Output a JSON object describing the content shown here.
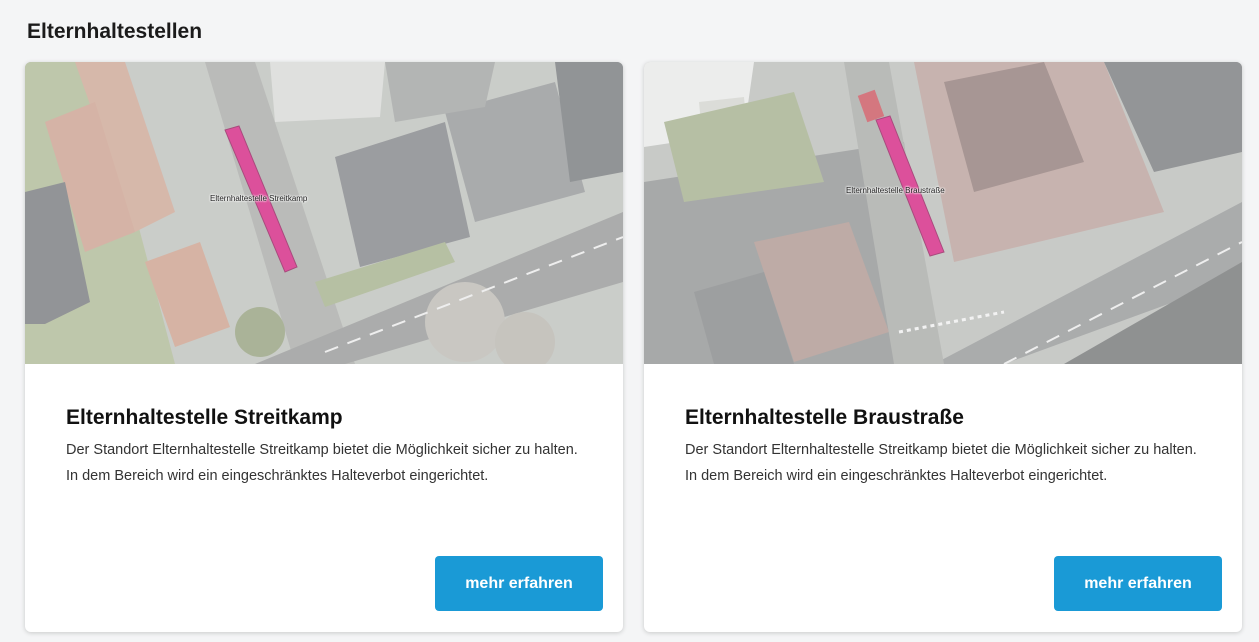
{
  "section": {
    "title": "Elternhaltestellen"
  },
  "cards": [
    {
      "title": "Elternhaltestelle Streitkamp",
      "map_label": "Elternhaltestelle Streitkamp",
      "description": "Der Standort Elternhaltestelle Streitkamp bietet die Möglichkeit sicher zu halten. In dem Bereich wird ein eingeschränktes Halteverbot eingerichtet.",
      "button": "mehr erfahren"
    },
    {
      "title": "Elternhaltestelle Braustraße",
      "map_label": "Elternhaltestelle Braustraße",
      "description": "Der Standort Elternhaltestelle Streitkamp bietet die Möglichkeit sicher zu halten. In dem Bereich wird ein eingeschränktes Halteverbot eingerichtet.",
      "button": "mehr erfahren"
    }
  ],
  "colors": {
    "accent": "#1a9ad6",
    "marker": "#d1167a"
  }
}
